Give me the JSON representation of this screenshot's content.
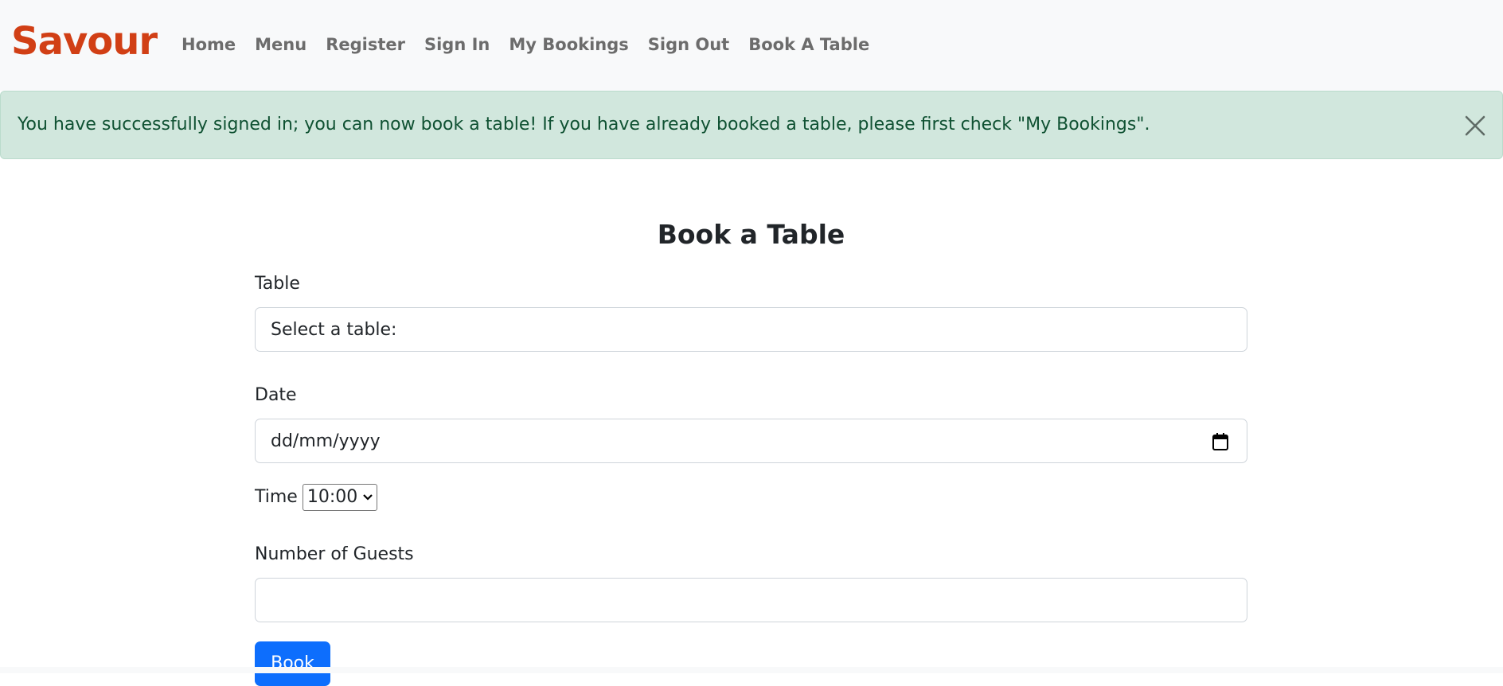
{
  "nav": {
    "brand": "Savour",
    "links": [
      "Home",
      "Menu",
      "Register",
      "Sign In",
      "My Bookings",
      "Sign Out",
      "Book A Table"
    ]
  },
  "alert": {
    "message": "You have successfully signed in; you can now book a table! If you have already booked a table, please first check \"My Bookings\".",
    "close_icon": "close-icon"
  },
  "form": {
    "title": "Book a Table",
    "table_label": "Table",
    "table_value": "Select a table:",
    "date_label": "Date",
    "date_placeholder": "dd/mm/yyyy",
    "time_label": "Time",
    "time_value": "10:00",
    "guests_label": "Number of Guests",
    "guests_value": "",
    "submit_label": "Book"
  },
  "colors": {
    "brand": "#d13f15",
    "alert_bg": "#d1e7dd",
    "alert_text": "#0f5132",
    "primary": "#0d6efd"
  }
}
